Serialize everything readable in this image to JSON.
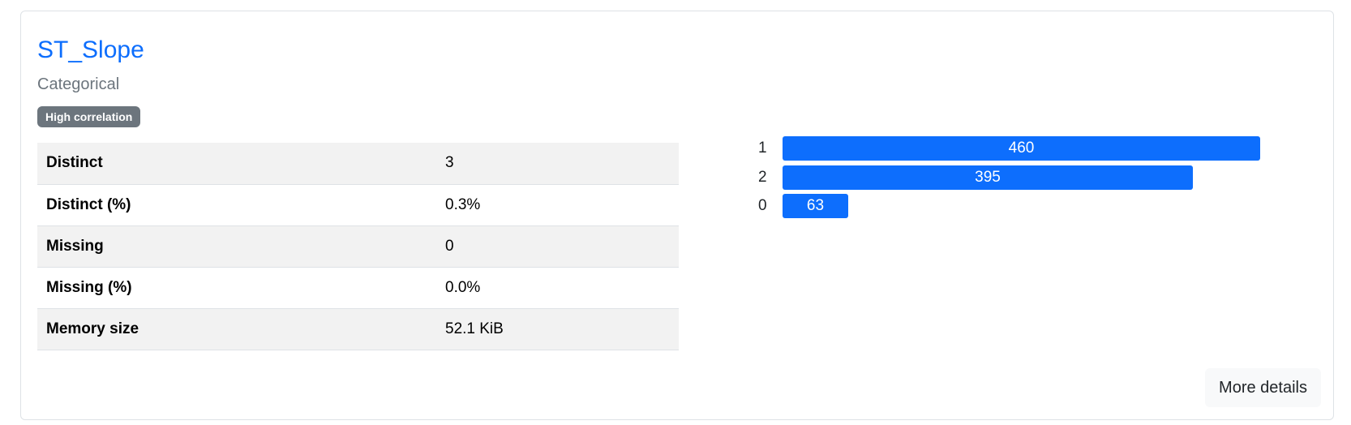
{
  "variable": {
    "name": "ST_Slope",
    "type": "Categorical",
    "badge": "High correlation"
  },
  "stats": [
    {
      "key": "Distinct",
      "value": "3"
    },
    {
      "key": "Distinct (%)",
      "value": "0.3%"
    },
    {
      "key": "Missing",
      "value": "0"
    },
    {
      "key": "Missing (%)",
      "value": "0.0%"
    },
    {
      "key": "Memory size",
      "value": "52.1 KiB"
    }
  ],
  "chart_data": {
    "type": "bar",
    "orientation": "horizontal",
    "categories": [
      "1",
      "2",
      "0"
    ],
    "values": [
      460,
      395,
      63
    ],
    "color": "#0d6efd",
    "xlim": [
      0,
      460
    ]
  },
  "actions": {
    "more_details": "More details"
  },
  "colors": {
    "accent": "#0d6efd",
    "badge": "#6c757d",
    "row_stripe": "#f2f2f2"
  }
}
